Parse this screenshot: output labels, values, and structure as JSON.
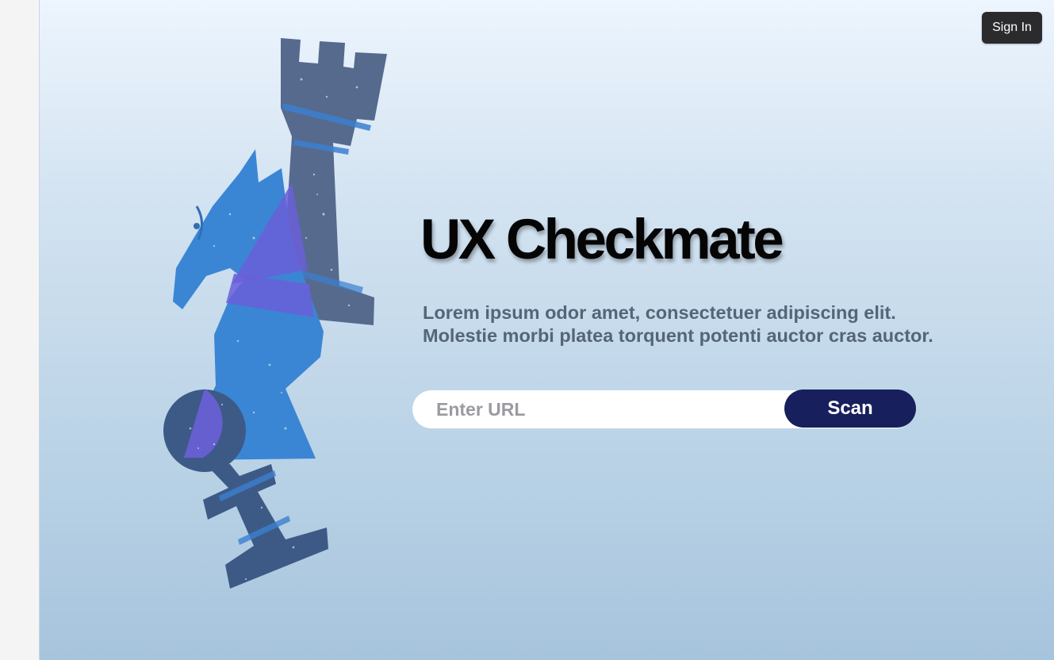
{
  "header": {
    "sign_in_label": "Sign In"
  },
  "hero": {
    "title": "UX Checkmate",
    "subtitle_line1": "Lorem ipsum odor amet, consectetuer adipiscing elit.",
    "subtitle_line2": "Molestie morbi platea torquent potenti auctor cras auctor."
  },
  "search": {
    "placeholder": "Enter URL",
    "value": "",
    "scan_label": "Scan"
  },
  "colors": {
    "accent": "#17205c",
    "sign_in_bg": "#2b2b2d",
    "knight": "#3a86d4",
    "rook": "#566a8e",
    "pawn": "#3d5a86",
    "highlight": "#6a5fd8"
  },
  "illustration": {
    "pieces": [
      "rook-icon",
      "knight-icon",
      "pawn-icon"
    ]
  }
}
